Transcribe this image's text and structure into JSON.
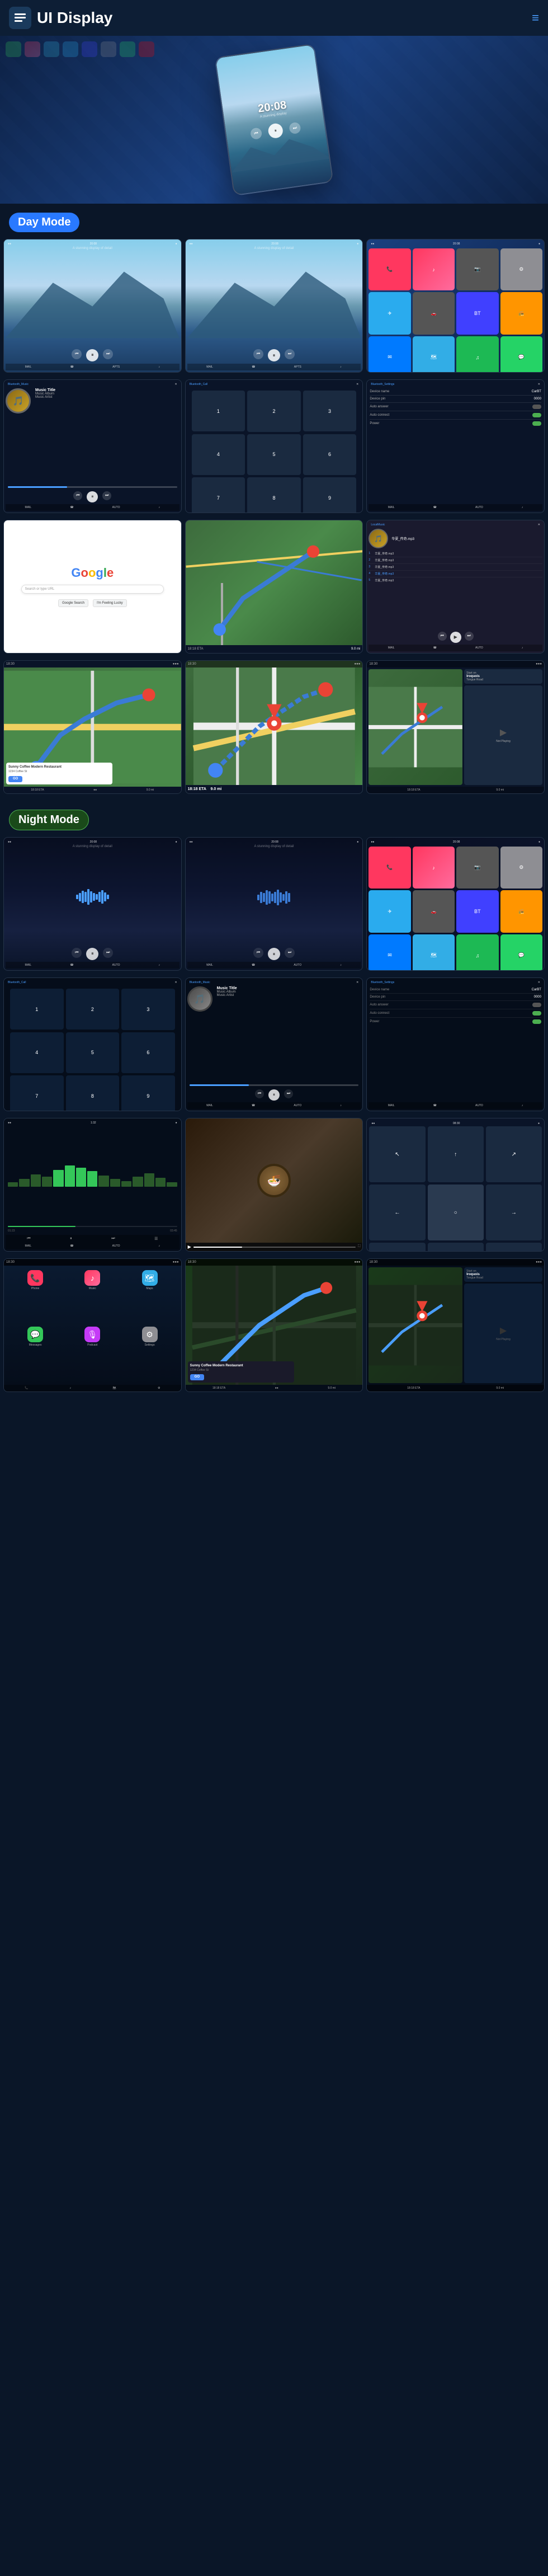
{
  "app": {
    "title": "UI Display"
  },
  "header": {
    "logo_icon": "☰",
    "title": "UI Display",
    "menu_icon": "≡"
  },
  "hero": {
    "device_time": "20:08",
    "subtitle": "A stunning display of detail"
  },
  "day_mode": {
    "label": "Day Mode"
  },
  "night_mode": {
    "label": "Night Mode"
  },
  "screens": {
    "music1": {
      "time": "20:08",
      "subtitle": "A stunning display of detail"
    },
    "music2": {
      "time": "20:08",
      "subtitle": "A stunning display of detail"
    },
    "bluetooth_music": {
      "title": "Bluetooth_Music",
      "track": "Music Title",
      "album": "Music Album",
      "artist": "Music Artist"
    },
    "bluetooth_call": {
      "title": "Bluetooth_Call"
    },
    "bluetooth_settings": {
      "title": "Bluetooth_Settings",
      "device_name_label": "Device name",
      "device_name_value": "CarBT",
      "device_pin_label": "Device pin",
      "device_pin_value": "0000",
      "auto_answer_label": "Auto answer",
      "auto_connect_label": "Auto connect",
      "power_label": "Power"
    },
    "google": {
      "search_placeholder": "Search or type URL"
    },
    "local_music": {
      "title": "LocalMusic",
      "tracks": [
        "华夏_传奇.mp3",
        "华夏_传奇.mp3",
        "华夏_传奇.mp3",
        "华夏_传奇.mp3",
        "华夏_传奇.mp3"
      ]
    },
    "navigation": {
      "eta": "18:18 ETA",
      "distance": "9.0 mi",
      "destination": "Start on Iroquois\nTongue Road"
    },
    "restaurant": {
      "name": "Sunny Coffee Modern Restaurant",
      "address": "1234 Coffee St, Modern City",
      "time": "18:18 ETA",
      "go_label": "GO"
    }
  },
  "colors": {
    "accent_blue": "#2979ff",
    "accent_green": "#4caf50",
    "night_section": "#1a4a1a",
    "background": "#0a1628",
    "card_bg": "#0d1e35"
  }
}
